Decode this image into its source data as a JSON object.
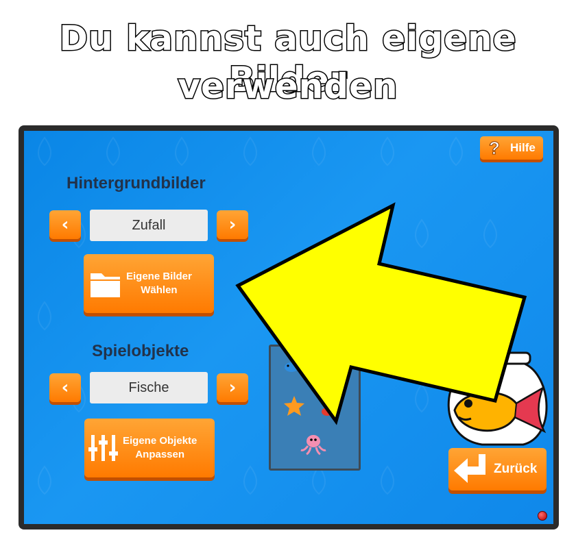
{
  "headline": {
    "line1": "Du kannst auch eigene Bilder",
    "line2": "verwenden"
  },
  "help_button": {
    "label": "Hilfe",
    "icon": "question-mark-icon"
  },
  "backgrounds": {
    "title": "Hintergrundbilder",
    "value": "Zufall",
    "prev_icon": "chevron-left-icon",
    "next_icon": "chevron-right-icon",
    "choose_button": {
      "line1": "Eigene Bilder",
      "line2": "Wählen",
      "icon": "folder-icon"
    }
  },
  "game_objects": {
    "title": "Spielobjekte",
    "value": "Fische",
    "prev_icon": "chevron-left-icon",
    "next_icon": "chevron-right-icon",
    "customize_button": {
      "line1": "Eigene Objekte",
      "line2": "Anpassen",
      "icon": "sliders-icon"
    }
  },
  "back_button": {
    "label": "Zurück",
    "icon": "return-arrow-icon"
  },
  "colors": {
    "screen_blue": "#0a86e6",
    "button_orange": "#ff8a10",
    "arrow_yellow": "#ffff00",
    "frame": "#2b2b2b"
  }
}
